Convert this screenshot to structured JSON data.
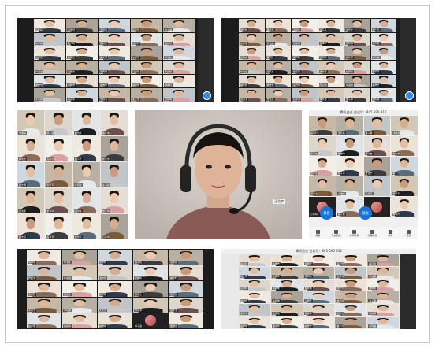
{
  "collage": {
    "panels": [
      {
        "id": "top-left",
        "rows": 6,
        "cols": 5,
        "names": [
          "张雨晴",
          "李浩然",
          "王思远",
          "陈佳怡",
          "刘子涵",
          "杨梦琪",
          "赵一鸣",
          "黄晓雯",
          "周子轩",
          "吴欣然",
          "徐嘉豪",
          "孙静怡",
          "胡文博",
          "朱梓萱",
          "高宇航",
          "林诗涵",
          "何俊杰",
          "郭雨桐",
          "马晨曦",
          "罗佳琪",
          "梁志远",
          "宋雨萱",
          "郑浩宇",
          "谢思琪",
          "韩明轩",
          "唐若曦",
          "冯子豪",
          "于婉清",
          "董天佑",
          "萧雅琳"
        ]
      },
      {
        "id": "top-right",
        "rows": 6,
        "cols": 6,
        "names": [
          "程欣怡",
          "曹俊豪",
          "袁梦瑶",
          "邓子墨",
          "许佳宁",
          "傅一凡",
          "沈雨涵",
          "曾浩然",
          "彭思雨",
          "吕泽宇",
          "苏晓晴",
          "卢子健",
          "蒋雅婷",
          "蔡明杰",
          "贾诗雨",
          "丁浩宇",
          "魏欣妍",
          "薛子恒",
          "叶雨嘉",
          "阎凯文",
          "余思彤",
          "潘志豪",
          "杜梦婷",
          "戴宇轩",
          "夏佳颖",
          "钟俊逸",
          "汪晓萌",
          "田子杰",
          "任雨欣",
          "姜浩天",
          "范思源",
          "方佳慧",
          "石宇泽",
          "姚梦洁",
          "谭子豪",
          "廖婉婷"
        ]
      },
      {
        "id": "middle-left",
        "rows": 5,
        "cols": 4,
        "names": [
          "邹雨婷",
          "熊子涵",
          "金浩然",
          "陆思琪",
          "郝俊杰",
          "孔雨欣",
          "白子轩",
          "崔佳怡",
          "康文博",
          "毛梓萱",
          "邱宇航",
          "秦诗涵",
          "江俊豪",
          "史雨桐",
          "顾晨曦",
          "侯佳琪",
          "邵志远",
          "孟雨萱",
          "龙浩宇",
          "万思琪"
        ]
      },
      {
        "id": "middle-right",
        "rows": 5,
        "cols": 4,
        "names": [
          "段明轩",
          "雷若曦",
          "钱子豪",
          "汤婉清",
          "尹天佑",
          "黎雅琳",
          "易欣怡",
          "常俊豪",
          "武梦瑶",
          "乔子墨",
          "贺佳宁",
          "赖一凡",
          "龚雨涵",
          "文浩然",
          "庞思雨",
          "樊泽宇",
          "兰晓晴",
          "殷子健",
          "施雅婷",
          "陶明杰"
        ]
      },
      {
        "id": "bottom-left",
        "rows": 5,
        "cols": 5,
        "names": [
          "洪诗雨",
          "翟浩宇",
          "安欣妍",
          "颜子恒",
          "倪雨嘉",
          "严凯文",
          "牛思彤",
          "温志豪",
          "芦梦婷",
          "季宇轩",
          "俞佳颖",
          "章俊逸",
          "鲁晓萌",
          "葛子杰",
          "伍雨欣",
          "韦浩天",
          "申思源",
          "尤佳慧",
          "毕宇泽",
          "聂梦洁",
          "丛子豪",
          "焦婉婷",
          "向雨婷",
          "柳子涵",
          "邢浩然"
        ]
      },
      {
        "id": "bottom-right",
        "rows": 6,
        "cols": 5,
        "names": [
          "路思琪",
          "岳俊杰",
          "齐雨欣",
          "沿子轩",
          "梅佳怡",
          "莫文博",
          "庄梓萱",
          "辛宇航",
          "管诗涵",
          "祝俊豪",
          "左雨桐",
          "涂晨曦",
          "谷佳琪",
          "时志远",
          "舒雨萱",
          "耿浩宇",
          "牟思琪",
          "卜明轩",
          "詹若曦",
          "关子豪",
          "苗婉清",
          "凌天佑",
          "费雅琳",
          "纪欣怡",
          "靳俊豪",
          "盛梦瑶",
          "童子墨",
          "欧佳宁",
          "甄一凡",
          "项雨涵"
        ]
      }
    ],
    "middle_right_top_bar": "腾讯会议 会议号：845 590 912",
    "middle_right_self_buttons": [
      "静音",
      "视频"
    ],
    "bottom_bar_items": [
      "静音",
      "开启视频",
      "共享屏幕",
      "管理成员",
      "聊天",
      "更多"
    ],
    "speaker": {
      "name_tag": "王浩宇"
    },
    "bottom_right_top_bar": "腾讯会议 会议号：845 590 912"
  },
  "colors": {
    "panel_bg": "#1c1c1c",
    "sidebar": "#2a2a2a",
    "accent_blue": "#2d8cf0",
    "frame_border": "#c8c8c8"
  }
}
